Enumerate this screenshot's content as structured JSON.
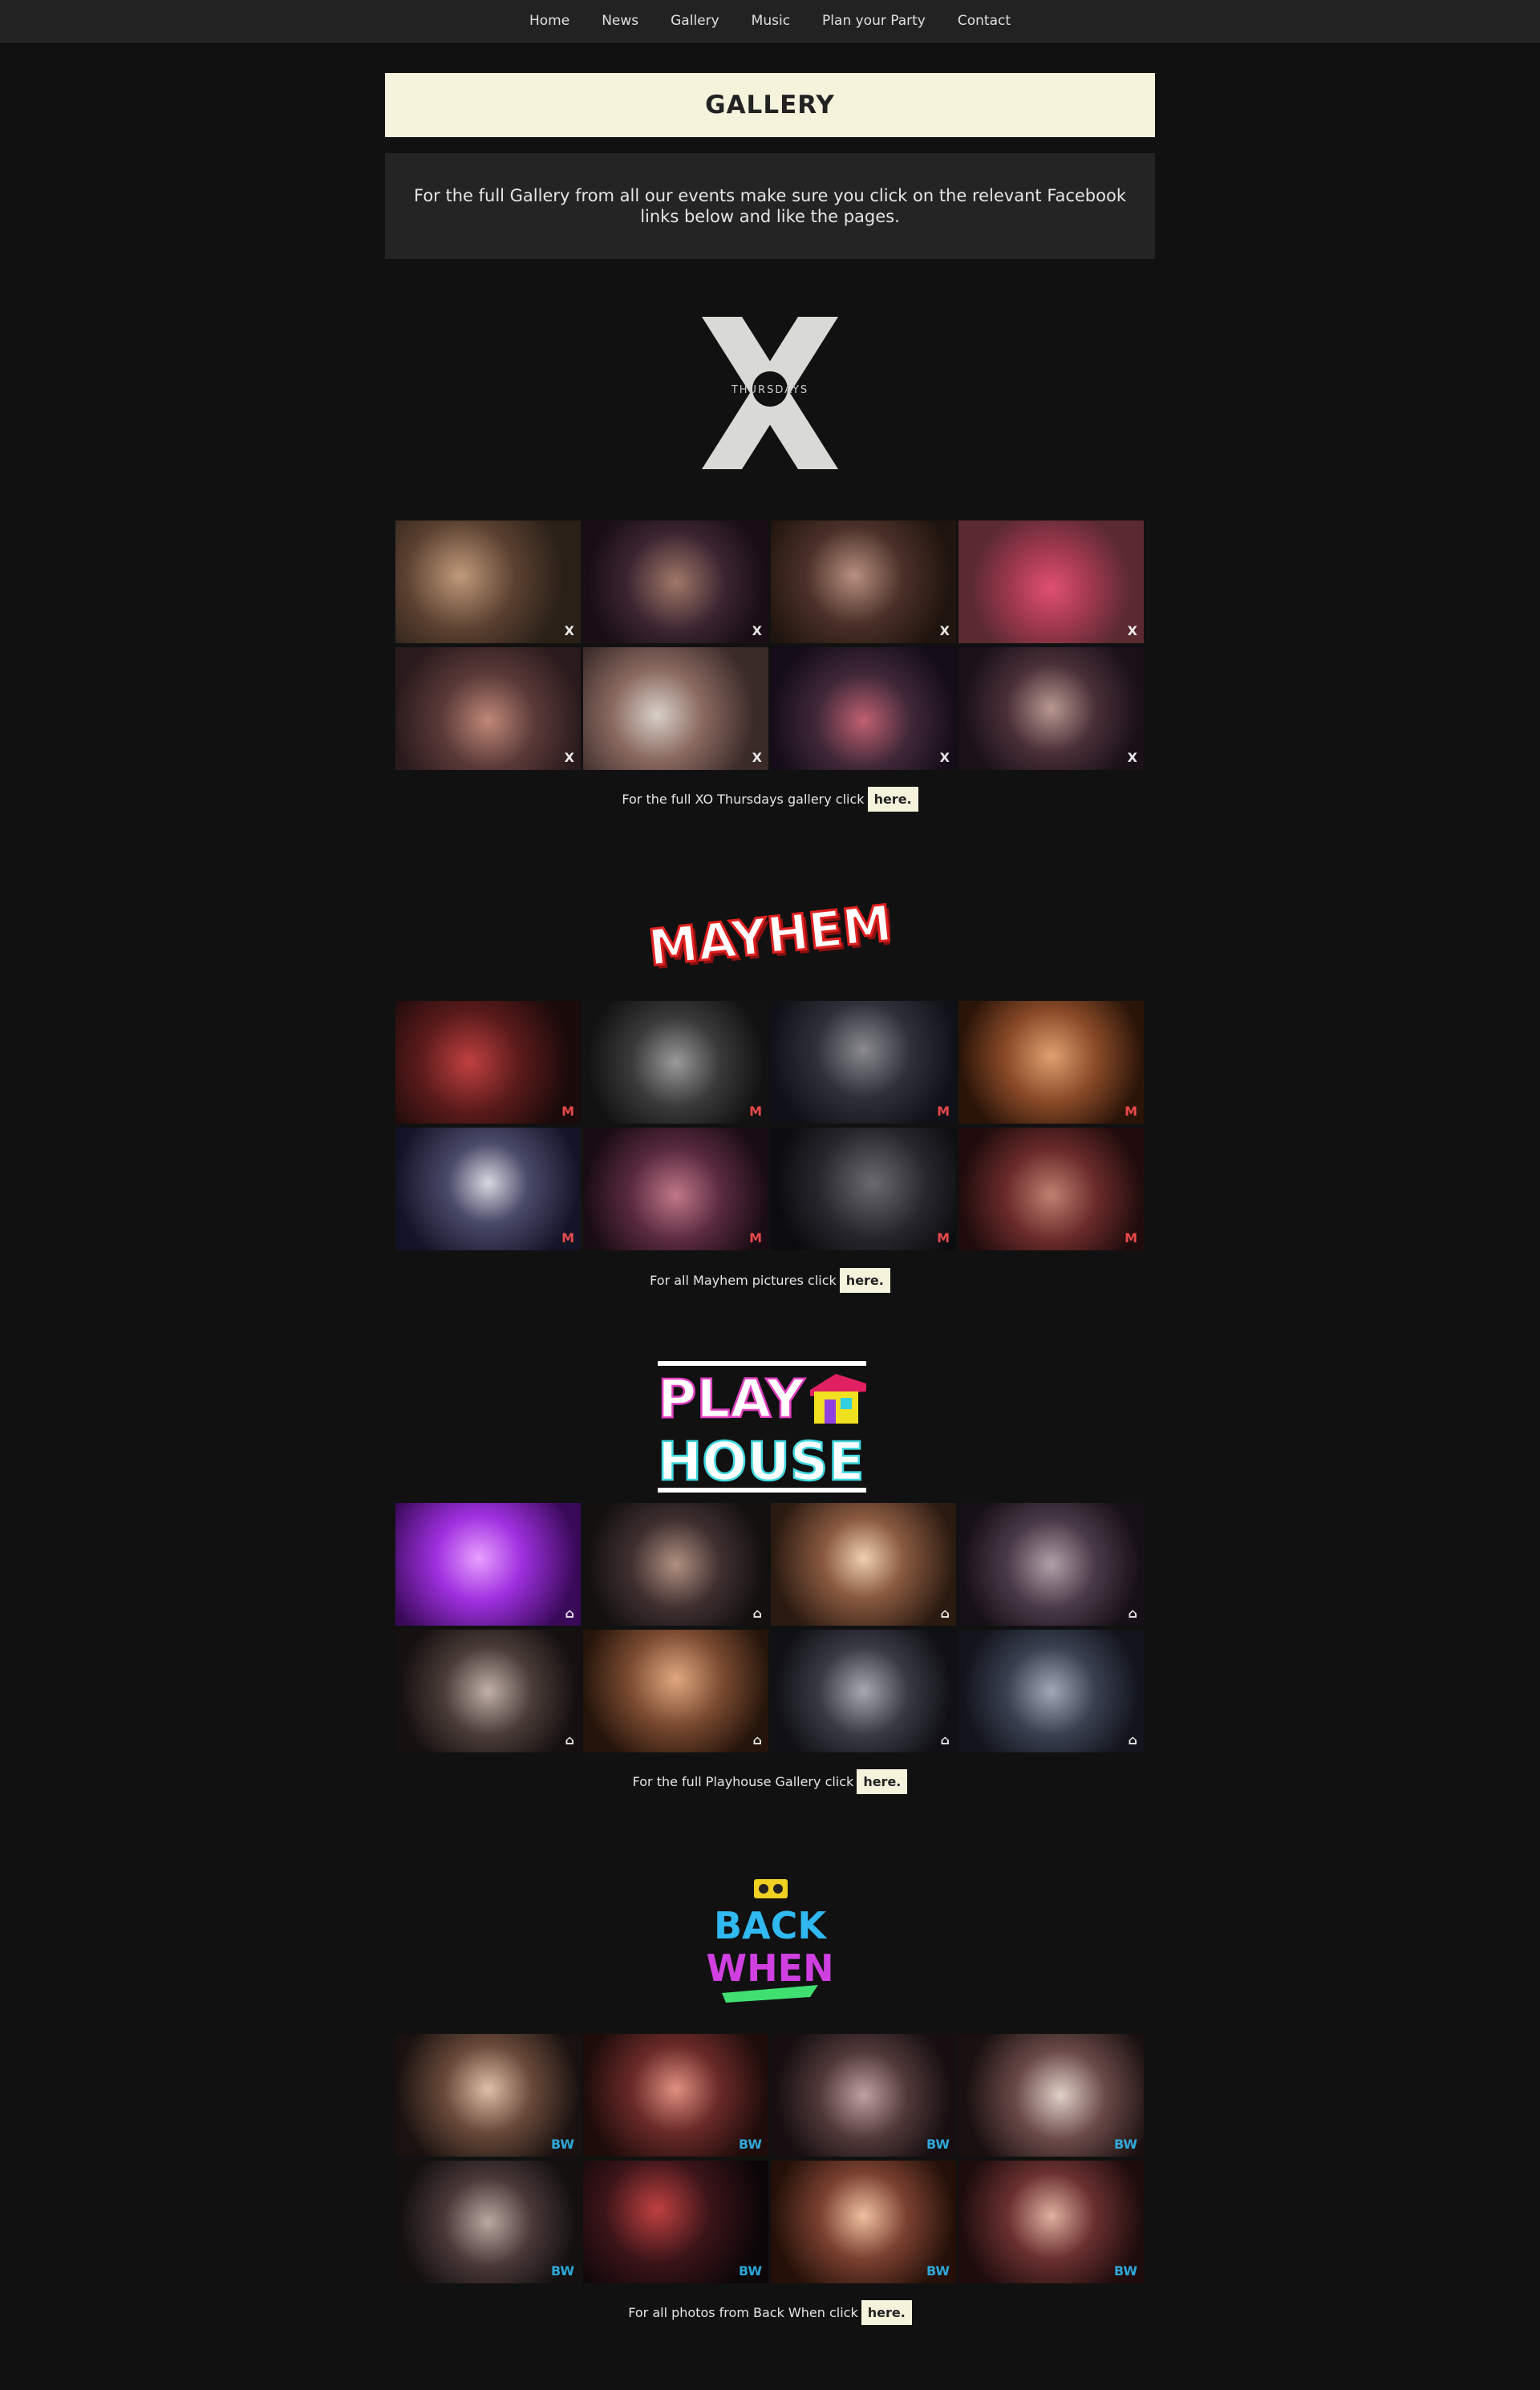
{
  "nav": {
    "items": [
      "Home",
      "News",
      "Gallery",
      "Music",
      "Plan your Party",
      "Contact"
    ]
  },
  "header": {
    "title": "GALLERY"
  },
  "intro": {
    "text": "For the full Gallery from all our events make sure you click on the relevant Facebook links below and like the pages."
  },
  "sections": [
    {
      "logo_text": "THURSDAYS",
      "caption": "For the full XO Thursdays gallery click",
      "link": "here."
    },
    {
      "logo_text": "MAYHEM",
      "caption": "For all Mayhem pictures click",
      "link": "here."
    },
    {
      "logo_text": "PLAY HOUSE",
      "caption": "For the full Playhouse Gallery click",
      "link": "here."
    },
    {
      "logo_text": "BACK WHEN",
      "caption": "For all photos from Back When click",
      "link": "here."
    }
  ],
  "colors": {
    "background": "#111111",
    "navbar": "#222222",
    "accent_cream": "#f5f3dc",
    "intro_box": "#242424"
  }
}
